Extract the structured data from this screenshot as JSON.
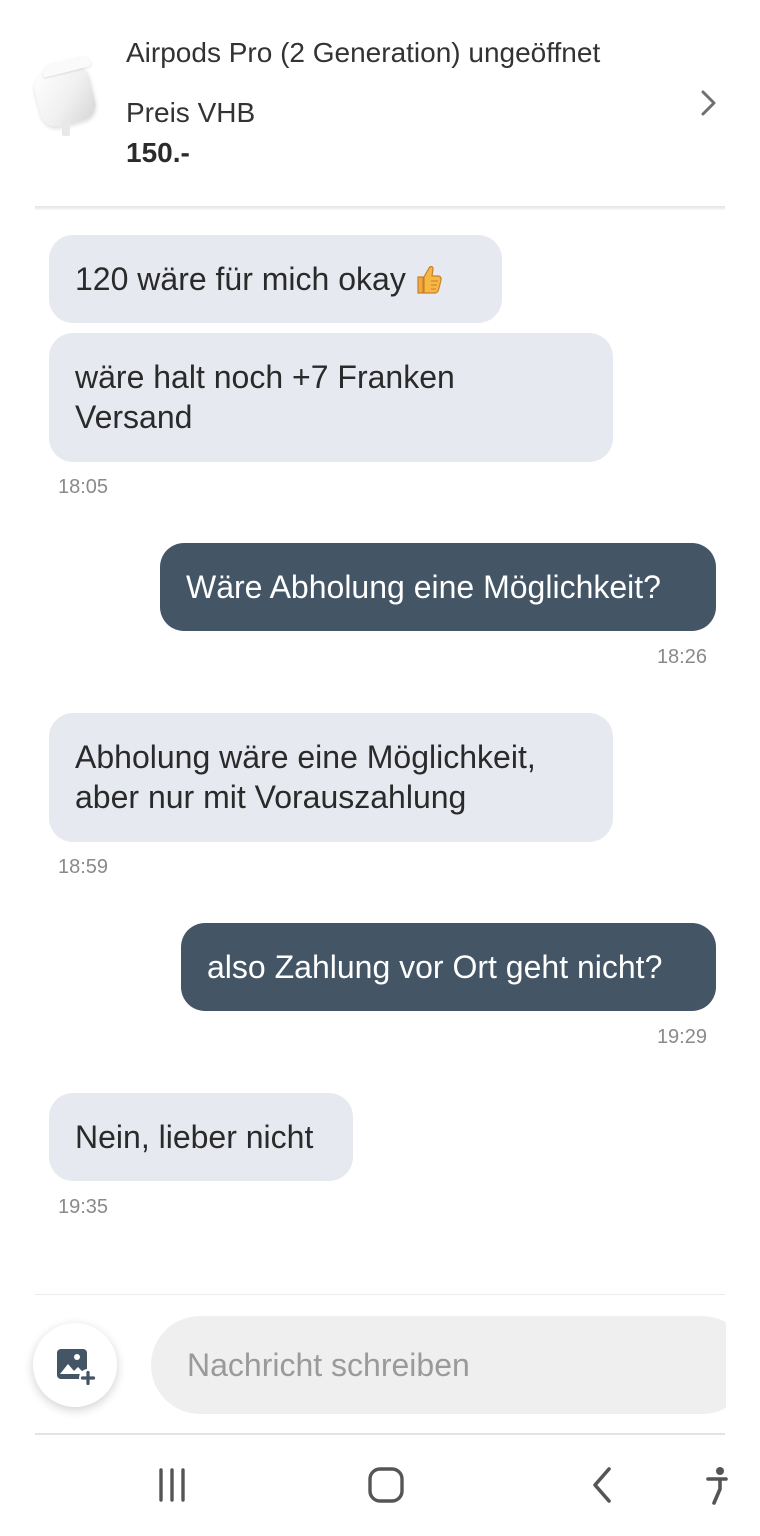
{
  "listing": {
    "title": "Airpods Pro (2 Generation) ungeöffnet",
    "price_label": "Preis VHB",
    "price": "150.-"
  },
  "messages": [
    {
      "direction": "in",
      "text": "120 wäre für mich okay",
      "emoji": "thumbs-up"
    },
    {
      "direction": "in",
      "text_line1": "wäre halt noch +7 Franken",
      "text_line2": "Versand",
      "time": "18:05"
    },
    {
      "direction": "out",
      "text": "Wäre Abholung eine Möglichkeit?",
      "time": "18:26"
    },
    {
      "direction": "in",
      "text_line1": "Abholung wäre eine Möglichkeit,",
      "text_line2": "aber nur mit Vorauszahlung",
      "time": "18:59"
    },
    {
      "direction": "out",
      "text": "also Zahlung vor Ort geht nicht?",
      "time": "19:29"
    },
    {
      "direction": "in",
      "text": "Nein, lieber nicht",
      "time": "19:35"
    }
  ],
  "composer": {
    "placeholder": "Nachricht schreiben",
    "value": "",
    "attach_icon": "add-photo-icon"
  },
  "navbar": {
    "icons": [
      "recent-apps-icon",
      "home-icon",
      "back-icon",
      "accessibility-icon"
    ]
  },
  "colors": {
    "incoming_bubble": "#e6e9ef",
    "outgoing_bubble": "#445566",
    "accent_icon": "#445566"
  }
}
